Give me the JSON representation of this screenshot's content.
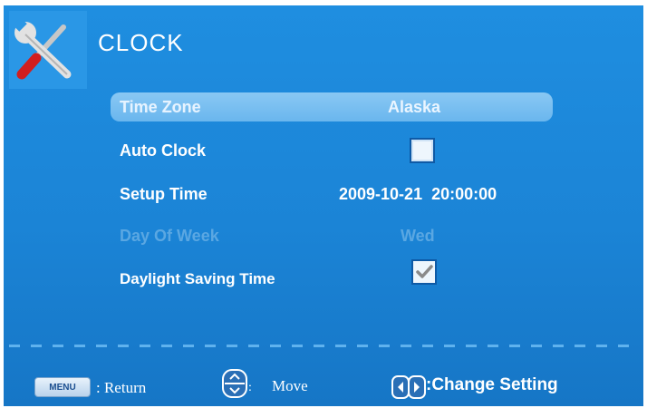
{
  "header": {
    "title": "CLOCK",
    "icon": "tools-icon"
  },
  "menu": {
    "rows": [
      {
        "label": "Time Zone",
        "value": "Alaska",
        "selected": true,
        "enabled": true
      },
      {
        "label": "Auto Clock",
        "checked": false,
        "enabled": true
      },
      {
        "label": "Setup Time",
        "value": "2009-10-21  20:00:00",
        "enabled": true
      },
      {
        "label": "Day Of Week",
        "value": "Wed",
        "enabled": false
      },
      {
        "label": "Daylight Saving Time",
        "checked": true,
        "enabled": true
      }
    ]
  },
  "footer": {
    "menu_key": "MENU",
    "return_text": ": Return",
    "move_text": "Move",
    "move_colon": ":",
    "change_text": ":Change Setting"
  },
  "colors": {
    "background": "#1b84d6",
    "highlight": "#7ec0f1",
    "disabled_text": "#5aa7e2"
  }
}
